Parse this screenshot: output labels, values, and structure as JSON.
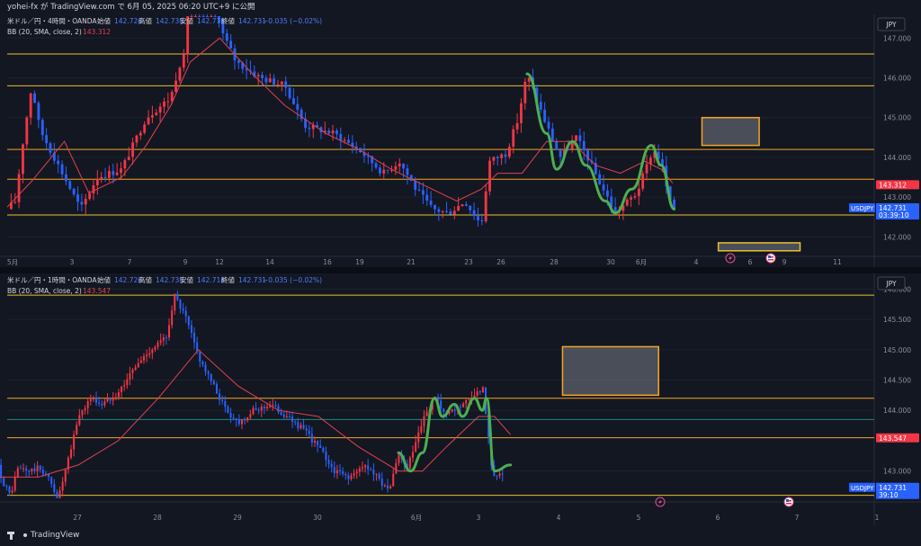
{
  "header": {
    "caption": "yohei-fx が TradingView.com で 6月 05, 2025 06:20 UTC+9 に公開"
  },
  "colors": {
    "bg": "#131722",
    "up": "#f23645",
    "down": "#2962ff",
    "bb": "#e0424f",
    "level_yellow": "#e6c32e",
    "level_orange": "#f5a623",
    "zigzag": "#4caf50",
    "grid": "#1e2230",
    "text": "#d1d4dc",
    "dim": "#8a8f9c"
  },
  "footer": {
    "logo": "TradingView"
  },
  "charts": [
    {
      "id": "pane1",
      "legend_symbol": "米ドル／円・4時間・OANDA",
      "legend_ohlc": [
        {
          "k": "始値",
          "v": "142.726"
        },
        {
          "k": "高値",
          "v": "142.738"
        },
        {
          "k": "安値",
          "v": "142.718"
        },
        {
          "k": "終値",
          "v": "142.731"
        }
      ],
      "legend_change": "−0.035 (−0.02%)",
      "legend_bb": "BB (20, SMA, close, 2)",
      "legend_bb_value": "143.312",
      "currency": "JPY",
      "tags": [
        {
          "label": "143.312",
          "price": 143.312,
          "color": "#f23645",
          "sub": ""
        },
        {
          "label": "142.731",
          "price": 142.731,
          "color": "#2962ff",
          "sub": "03:39:10"
        }
      ],
      "symbol_tag": "USDJPY",
      "y_ticks": [
        "147.000",
        "146.000",
        "145.000",
        "144.000",
        "143.000",
        "142.000"
      ],
      "x_ticks": [
        "5月",
        "3",
        "7",
        "9",
        "12",
        "14",
        "16",
        "19",
        "21",
        "23",
        "26",
        "28",
        "30",
        "6月",
        "4",
        "6",
        "9",
        "11"
      ]
    },
    {
      "id": "pane2",
      "legend_symbol": "米ドル／円・1時間・OANDA",
      "legend_ohlc": [
        {
          "k": "始値",
          "v": "142.726"
        },
        {
          "k": "高値",
          "v": "142.738"
        },
        {
          "k": "安値",
          "v": "142.718"
        },
        {
          "k": "終値",
          "v": "142.731"
        }
      ],
      "legend_change": "−0.035 (−0.02%)",
      "legend_bb": "BB (20, SMA, close, 2)",
      "legend_bb_value": "143.547",
      "currency": "JPY",
      "tags": [
        {
          "label": "143.547",
          "price": 143.547,
          "color": "#f23645",
          "sub": ""
        },
        {
          "label": "142.731",
          "price": 142.731,
          "color": "#2962ff",
          "sub": "39:10"
        }
      ],
      "symbol_tag": "USDJPY",
      "y_ticks": [
        "146.000",
        "145.500",
        "145.000",
        "144.500",
        "144.000",
        "143.000"
      ],
      "x_ticks": [
        "27",
        "28",
        "29",
        "30",
        "6月",
        "3",
        "4",
        "5",
        "6",
        "7",
        "1"
      ]
    }
  ],
  "chart_data": [
    {
      "type": "candlestick",
      "title": "米ドル／円・4時間・OANDA",
      "ylim": [
        141.6,
        147.55
      ],
      "x": [
        "5月",
        "3",
        "7",
        "9",
        "12",
        "14",
        "16",
        "19",
        "21",
        "23",
        "26",
        "28",
        "30",
        "6月",
        "4",
        "6",
        "9",
        "11"
      ],
      "anchors": [
        [
          0,
          142.7
        ],
        [
          0.05,
          142.9
        ],
        [
          0.1,
          144.5
        ],
        [
          0.15,
          145.8
        ],
        [
          0.2,
          144.7
        ],
        [
          0.3,
          143.9
        ],
        [
          0.45,
          142.7
        ],
        [
          0.55,
          143.5
        ],
        [
          0.7,
          143.7
        ],
        [
          0.85,
          145.0
        ],
        [
          1.0,
          145.5
        ],
        [
          1.05,
          146.3
        ],
        [
          1.08,
          146.5
        ],
        [
          1.12,
          148.5
        ],
        [
          1.25,
          148.2
        ],
        [
          1.32,
          147.1
        ],
        [
          1.4,
          146.4
        ],
        [
          1.55,
          146.0
        ],
        [
          1.7,
          145.8
        ],
        [
          1.82,
          144.8
        ],
        [
          2.0,
          144.6
        ],
        [
          2.15,
          144.2
        ],
        [
          2.3,
          143.6
        ],
        [
          2.4,
          143.9
        ],
        [
          2.5,
          143.2
        ],
        [
          2.6,
          142.7
        ],
        [
          2.7,
          142.6
        ],
        [
          2.8,
          142.9
        ],
        [
          2.9,
          142.3
        ],
        [
          2.95,
          143.9
        ],
        [
          3.05,
          144.1
        ],
        [
          3.12,
          144.9
        ],
        [
          3.18,
          146.1
        ],
        [
          3.28,
          145.0
        ],
        [
          3.38,
          144.0
        ],
        [
          3.48,
          144.5
        ],
        [
          3.55,
          144.0
        ],
        [
          3.62,
          143.4
        ],
        [
          3.72,
          142.6
        ],
        [
          3.85,
          143.1
        ],
        [
          3.95,
          144.2
        ],
        [
          4.0,
          143.9
        ],
        [
          4.05,
          142.9
        ],
        [
          4.08,
          142.7
        ]
      ],
      "bb_basis": [
        [
          0,
          142.75
        ],
        [
          0.15,
          143.4
        ],
        [
          0.35,
          144.4
        ],
        [
          0.5,
          143.1
        ],
        [
          0.7,
          143.5
        ],
        [
          0.85,
          144.3
        ],
        [
          1.0,
          145.3
        ],
        [
          1.12,
          146.4
        ],
        [
          1.3,
          147.0
        ],
        [
          1.5,
          146.1
        ],
        [
          1.7,
          145.3
        ],
        [
          1.95,
          144.6
        ],
        [
          2.15,
          144.2
        ],
        [
          2.35,
          143.7
        ],
        [
          2.55,
          143.3
        ],
        [
          2.75,
          142.9
        ],
        [
          2.9,
          143.2
        ],
        [
          3.0,
          143.6
        ],
        [
          3.15,
          143.6
        ],
        [
          3.3,
          144.4
        ],
        [
          3.45,
          144.4
        ],
        [
          3.6,
          143.8
        ],
        [
          3.75,
          143.6
        ],
        [
          3.9,
          143.9
        ],
        [
          4.0,
          143.7
        ],
        [
          4.07,
          143.35
        ]
      ],
      "zigzag": [
        [
          3.18,
          146.1
        ],
        [
          3.3,
          144.6
        ],
        [
          3.36,
          143.7
        ],
        [
          3.46,
          144.4
        ],
        [
          3.54,
          143.8
        ],
        [
          3.66,
          142.9
        ],
        [
          3.72,
          142.6
        ],
        [
          3.82,
          143.2
        ],
        [
          3.94,
          144.3
        ],
        [
          4.0,
          143.8
        ],
        [
          4.08,
          142.7
        ]
      ],
      "horizontal_levels": [
        {
          "price": 146.6,
          "color": "yellow"
        },
        {
          "price": 145.8,
          "color": "yellow"
        },
        {
          "price": 144.2,
          "color": "orange"
        },
        {
          "price": 143.45,
          "color": "orange"
        },
        {
          "price": 142.55,
          "color": "yellow"
        }
      ],
      "zones": [
        {
          "x0": 4.25,
          "x1": 4.6,
          "y0": 144.3,
          "y1": 145.0,
          "color": "orange"
        },
        {
          "x0": 4.35,
          "x1": 4.85,
          "y0": 141.65,
          "y1": 141.85,
          "color": "yellow"
        }
      ]
    },
    {
      "type": "candlestick",
      "title": "米ドル／円・1時間・OANDA",
      "ylim": [
        142.55,
        146.05
      ],
      "x": [
        "27",
        "28",
        "29",
        "30",
        "6月",
        "3",
        "4",
        "5",
        "6",
        "7",
        "1"
      ],
      "anchors": [
        [
          0,
          143.1
        ],
        [
          0.05,
          142.85
        ],
        [
          0.15,
          142.6
        ],
        [
          0.25,
          143.05
        ],
        [
          0.4,
          143.0
        ],
        [
          0.5,
          143.05
        ],
        [
          0.6,
          142.95
        ],
        [
          0.75,
          142.55
        ],
        [
          0.9,
          143.3
        ],
        [
          1.0,
          143.9
        ],
        [
          1.15,
          144.2
        ],
        [
          1.3,
          144.1
        ],
        [
          1.5,
          144.3
        ],
        [
          1.7,
          144.7
        ],
        [
          1.9,
          145.0
        ],
        [
          2.1,
          145.2
        ],
        [
          2.2,
          145.9
        ],
        [
          2.35,
          145.5
        ],
        [
          2.5,
          144.9
        ],
        [
          2.65,
          144.5
        ],
        [
          2.85,
          144.0
        ],
        [
          3.0,
          143.8
        ],
        [
          3.2,
          144.0
        ],
        [
          3.4,
          144.1
        ],
        [
          3.6,
          143.9
        ],
        [
          3.8,
          143.7
        ],
        [
          4.0,
          143.4
        ],
        [
          4.2,
          143.0
        ],
        [
          4.4,
          142.9
        ],
        [
          4.6,
          143.1
        ],
        [
          4.8,
          142.8
        ],
        [
          4.9,
          142.7
        ],
        [
          5.0,
          143.3
        ],
        [
          5.1,
          143.0
        ],
        [
          5.3,
          143.8
        ],
        [
          5.45,
          144.2
        ],
        [
          5.6,
          143.9
        ],
        [
          5.8,
          144.1
        ],
        [
          5.95,
          144.2
        ],
        [
          6.05,
          144.4
        ],
        [
          6.15,
          143.2
        ],
        [
          6.2,
          142.9
        ],
        [
          6.3,
          142.95
        ]
      ],
      "bb_basis": [
        [
          0,
          142.9
        ],
        [
          0.5,
          142.9
        ],
        [
          1.0,
          143.1
        ],
        [
          1.5,
          143.5
        ],
        [
          2.0,
          144.2
        ],
        [
          2.5,
          145.0
        ],
        [
          3.0,
          144.4
        ],
        [
          3.5,
          144.0
        ],
        [
          4.0,
          143.9
        ],
        [
          4.5,
          143.4
        ],
        [
          5.0,
          143.0
        ],
        [
          5.3,
          143.0
        ],
        [
          5.6,
          143.4
        ],
        [
          6.0,
          143.9
        ],
        [
          6.2,
          143.9
        ],
        [
          6.4,
          143.6
        ]
      ],
      "zigzag": [
        [
          5.0,
          143.3
        ],
        [
          5.15,
          143.0
        ],
        [
          5.3,
          143.3
        ],
        [
          5.45,
          144.2
        ],
        [
          5.55,
          143.9
        ],
        [
          5.7,
          144.1
        ],
        [
          5.8,
          143.9
        ],
        [
          5.95,
          144.2
        ],
        [
          6.05,
          144.0
        ],
        [
          6.1,
          144.2
        ],
        [
          6.2,
          143.0
        ],
        [
          6.4,
          143.1
        ]
      ],
      "horizontal_levels": [
        {
          "price": 145.9,
          "color": "yellow"
        },
        {
          "price": 144.2,
          "color": "orange"
        },
        {
          "price": 143.85,
          "color": "teal"
        },
        {
          "price": 143.55,
          "color": "orange"
        },
        {
          "price": 142.6,
          "color": "yellow"
        }
      ],
      "zones": [
        {
          "x0": 7.05,
          "x1": 8.25,
          "y0": 144.25,
          "y1": 145.05,
          "color": "orange"
        }
      ]
    }
  ]
}
